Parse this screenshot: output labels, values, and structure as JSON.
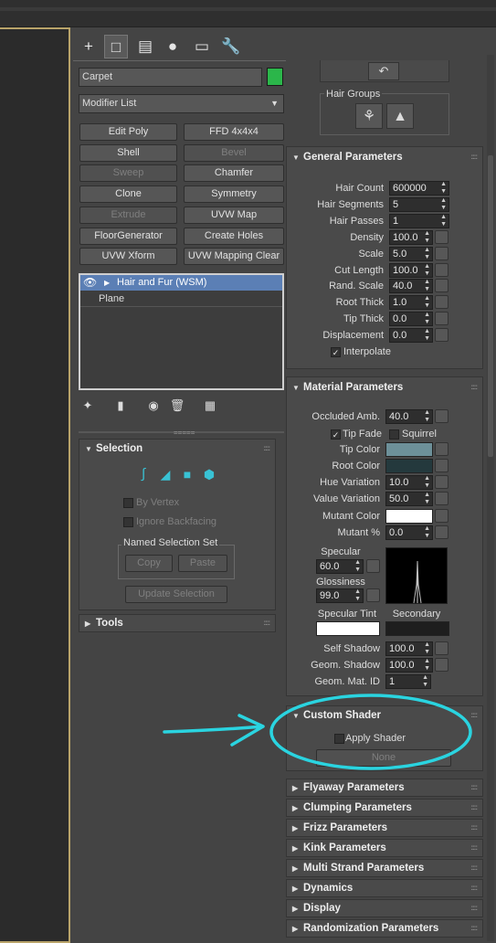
{
  "object_name": "Carpet",
  "object_color": "#2bb64a",
  "modifier_list": "Modifier List",
  "modifier_buttons": [
    {
      "label": "Edit Poly",
      "enabled": true
    },
    {
      "label": "FFD 4x4x4",
      "enabled": true
    },
    {
      "label": "Shell",
      "enabled": true
    },
    {
      "label": "Bevel",
      "enabled": false
    },
    {
      "label": "Sweep",
      "enabled": false
    },
    {
      "label": "Chamfer",
      "enabled": true
    },
    {
      "label": "Clone",
      "enabled": true
    },
    {
      "label": "Symmetry",
      "enabled": true
    },
    {
      "label": "Extrude",
      "enabled": false
    },
    {
      "label": "UVW Map",
      "enabled": true
    },
    {
      "label": "FloorGenerator",
      "enabled": true
    },
    {
      "label": "Create Holes",
      "enabled": true
    },
    {
      "label": "UVW Xform",
      "enabled": true
    },
    {
      "label": "UVW Mapping Clear",
      "enabled": true
    }
  ],
  "stack": {
    "items": [
      "Hair and Fur (WSM)",
      "Plane"
    ],
    "selected_index": 0
  },
  "selection": {
    "title": "Selection",
    "by_vertex": "By Vertex",
    "ignore_backfacing": "Ignore Backfacing",
    "named_selection_set": "Named Selection Set",
    "copy": "Copy",
    "paste": "Paste",
    "update_selection": "Update Selection"
  },
  "tools": {
    "title": "Tools"
  },
  "hair_groups": {
    "title": "Hair Groups"
  },
  "general": {
    "title": "General Parameters",
    "rows": [
      {
        "label": "Hair Count",
        "value": "600000",
        "map": false
      },
      {
        "label": "Hair Segments",
        "value": "5",
        "map": false
      },
      {
        "label": "Hair Passes",
        "value": "1",
        "map": false
      },
      {
        "label": "Density",
        "value": "100.0",
        "map": true
      },
      {
        "label": "Scale",
        "value": "5.0",
        "map": true
      },
      {
        "label": "Cut Length",
        "value": "100.0",
        "map": true
      },
      {
        "label": "Rand. Scale",
        "value": "40.0",
        "map": true
      },
      {
        "label": "Root Thick",
        "value": "1.0",
        "map": true
      },
      {
        "label": "Tip Thick",
        "value": "0.0",
        "map": true
      },
      {
        "label": "Displacement",
        "value": "0.0",
        "map": true
      }
    ],
    "interpolate": "Interpolate"
  },
  "material": {
    "title": "Material Parameters",
    "occluded_amb_label": "Occluded Amb.",
    "occluded_amb_value": "40.0",
    "tip_fade": "Tip Fade",
    "squirrel": "Squirrel",
    "tip_color_label": "Tip Color",
    "tip_color": "#6d9099",
    "root_color_label": "Root Color",
    "root_color": "#24393d",
    "hue_variation_label": "Hue Variation",
    "hue_variation_value": "10.0",
    "value_variation_label": "Value Variation",
    "value_variation_value": "50.0",
    "mutant_color_label": "Mutant Color",
    "mutant_color": "#ffffff",
    "mutant_pct_label": "Mutant %",
    "mutant_pct_value": "0.0",
    "specular_label": "Specular",
    "specular_value": "60.0",
    "glossiness_label": "Glossiness",
    "glossiness_value": "99.0",
    "specular_tint_label": "Specular Tint",
    "specular_tint": "#ffffff",
    "secondary_label": "Secondary",
    "secondary": "#1e1e1e",
    "self_shadow_label": "Self Shadow",
    "self_shadow_value": "100.0",
    "geom_shadow_label": "Geom. Shadow",
    "geom_shadow_value": "100.0",
    "geom_mat_id_label": "Geom. Mat. ID",
    "geom_mat_id_value": "1"
  },
  "custom_shader": {
    "title": "Custom Shader",
    "apply_shader": "Apply Shader",
    "none": "None"
  },
  "collapsed_rollouts": [
    "Flyaway Parameters",
    "Clumping Parameters",
    "Frizz Parameters",
    "Kink Parameters",
    "Multi Strand Parameters",
    "Dynamics",
    "Display",
    "Randomization Parameters"
  ],
  "annotation_color": "#2ad4e0"
}
